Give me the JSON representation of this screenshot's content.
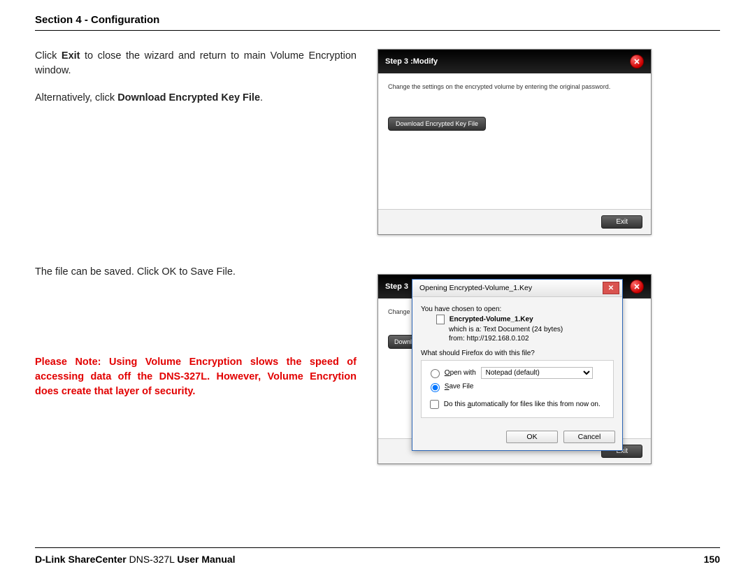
{
  "header": {
    "section": "Section 4 - Configuration"
  },
  "left": {
    "p1a": "Click ",
    "p1b": "Exit",
    "p1c": " to close the wizard and return to main Volume Encryption window.",
    "p2a": "Alternatively, click ",
    "p2b": "Download Encrypted Key File",
    "p2c": ".",
    "p3": "The file can be saved.  Click OK to Save File.",
    "note": "Please Note: Using Volume Encryption slows the speed of accessing data off the DNS-327L. However, Volume Encrytion does create that layer of security",
    "note_period": "."
  },
  "wizard1": {
    "title": "Step 3 :Modify",
    "instr": "Change the settings on the encrypted volume by entering the original password.",
    "download_btn": "Download Encrypted Key File",
    "exit": "Exit"
  },
  "wizard2": {
    "title_partial": "Step 3",
    "instr_partial": "Change th",
    "download_partial": "Downl",
    "exit": "Exit"
  },
  "dialog": {
    "title": "Opening Encrypted-Volume_1.Key",
    "chosen": "You have chosen to open:",
    "filename": "Encrypted-Volume_1.Key",
    "which_is": "which is a:  Text Document (24 bytes)",
    "from": "from:  http://192.168.0.102",
    "question": "What should Firefox do with this file?",
    "open_with": "Open with",
    "open_with_app": "Notepad (default)",
    "save_file": "Save File",
    "auto": "Do this automatically for files like this from now on.",
    "ok": "OK",
    "cancel": "Cancel"
  },
  "footer": {
    "left_a": "D-Link ShareCenter",
    "left_b": " DNS-327L ",
    "left_c": "User Manual",
    "page": "150"
  }
}
